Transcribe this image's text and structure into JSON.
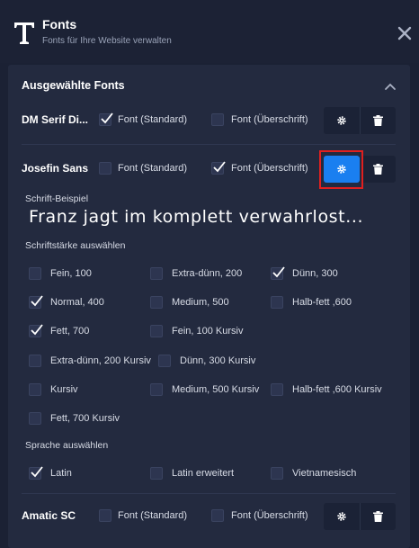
{
  "header": {
    "title": "Fonts",
    "subtitle": "Fonts für Ihre Website verwalten",
    "logo_icon": "serif-T-icon",
    "close_icon": "close-icon"
  },
  "section": {
    "title": "Ausgewählte Fonts",
    "collapse_icon": "chevron-up-icon"
  },
  "colors": {
    "accent": "#1a7ff0",
    "highlight": "#e0201f",
    "panel": "#232a3f",
    "background": "#1b2134"
  },
  "fonts": [
    {
      "name": "DM Serif Di...",
      "standard_label": "Font (Standard)",
      "standard_checked": true,
      "heading_label": "Font (Überschrift)",
      "heading_checked": false
    },
    {
      "name": "Josefin Sans",
      "standard_label": "Font (Standard)",
      "standard_checked": false,
      "heading_label": "Font (Überschrift)",
      "heading_checked": true
    },
    {
      "name": "Amatic SC",
      "standard_label": "Font (Standard)",
      "standard_checked": false,
      "heading_label": "Font (Überschrift)",
      "heading_checked": false
    }
  ],
  "details": {
    "sample_label": "Schrift-Beispiel",
    "sample_text": "Franz jagt im komplett verwahrlost...",
    "weights_label": "Schriftstärke auswählen",
    "weights": [
      {
        "label": "Fein, 100",
        "checked": false
      },
      {
        "label": "Extra-dünn, 200",
        "checked": false
      },
      {
        "label": "Dünn, 300",
        "checked": true
      },
      {
        "label": "Normal, 400",
        "checked": true
      },
      {
        "label": "Medium, 500",
        "checked": false
      },
      {
        "label": "Halb-fett ,600",
        "checked": false
      },
      {
        "label": "Fett, 700",
        "checked": true
      },
      {
        "label": "Fein, 100 Kursiv",
        "checked": false
      },
      {
        "label": "Extra-dünn, 200 Kursiv",
        "checked": false
      },
      {
        "label": "Dünn, 300 Kursiv",
        "checked": false
      },
      {
        "label": "Kursiv",
        "checked": false
      },
      {
        "label": "Medium, 500 Kursiv",
        "checked": false
      },
      {
        "label": "Halb-fett ,600 Kursiv",
        "checked": false
      },
      {
        "label": "Fett, 700 Kursiv",
        "checked": false
      }
    ],
    "language_label": "Sprache auswählen",
    "languages": [
      {
        "label": "Latin",
        "checked": true
      },
      {
        "label": "Latin erweitert",
        "checked": false
      },
      {
        "label": "Vietnamesisch",
        "checked": false
      }
    ]
  }
}
